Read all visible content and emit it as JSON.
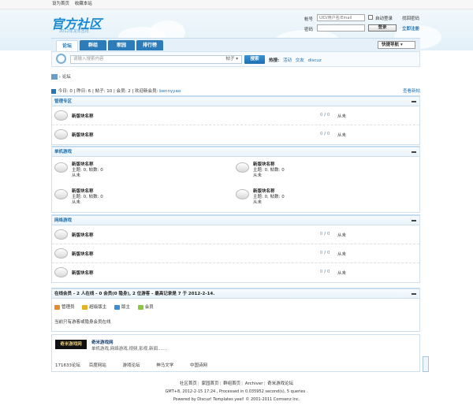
{
  "topbar": {
    "set_home": "设为首页",
    "bookmark": "收藏本站"
  },
  "logo": {
    "title": "官方社区",
    "subtitle": "2012年龙年吉祥"
  },
  "login": {
    "account_label": "帐号",
    "account_placeholder": "UID/用户名/Email",
    "remember": "自动登录",
    "forgot": "找回密码",
    "password_label": "密码",
    "login_button": "登录",
    "register": "立即注册"
  },
  "nav": {
    "tabs": [
      "论坛",
      "群组",
      "家园",
      "排行榜"
    ],
    "quick": "快捷导航"
  },
  "search": {
    "placeholder": "请输入搜索内容",
    "type": "帖子",
    "button": "搜索",
    "hot_label": "热搜:",
    "hot": [
      "活动",
      "交友",
      "discuz"
    ]
  },
  "breadcrumb": {
    "current": "论坛"
  },
  "stats": {
    "text": "今日: 0 | 昨日: 6 | 帖子: 10 | 会员: 2 | 欢迎新会员:",
    "new_member": "bennyyao",
    "latest": "查看新帖"
  },
  "sections": {
    "admin": {
      "title": "管理专区",
      "forums": [
        {
          "name": "新版块名称",
          "count": "0",
          "posts": "0",
          "last": "从未"
        },
        {
          "name": "新版块名称",
          "count": "0",
          "posts": "0",
          "last": "从未"
        }
      ]
    },
    "single": {
      "title": "单机游戏",
      "forums": [
        {
          "name": "新版块名称",
          "meta": "主题: 0, 帖数: 0",
          "last": "从未"
        },
        {
          "name": "新版块名称",
          "meta": "主题: 0, 帖数: 0",
          "last": "从未"
        },
        {
          "name": "新版块名称",
          "meta": "主题: 0, 帖数: 0",
          "last": "从未"
        },
        {
          "name": "新版块名称",
          "meta": "主题: 0, 帖数: 0",
          "last": "从未"
        }
      ]
    },
    "online_game": {
      "title": "网络游戏",
      "forums": [
        {
          "name": "新版块名称",
          "count": "0",
          "posts": "0",
          "last": "从未"
        },
        {
          "name": "新版块名称",
          "count": "0",
          "posts": "0",
          "last": "从未"
        },
        {
          "name": "新版块名称",
          "count": "0",
          "posts": "0",
          "last": "从未"
        }
      ]
    }
  },
  "online": {
    "title": "在线会员 - 2 人在线 - 0 会员(0 隐身), 2 位游客 - 最高记录是 7 于 2012-2-14.",
    "legend": [
      {
        "label": "管理员",
        "color": "#e78a2e"
      },
      {
        "label": "超级版主",
        "color": "#e4b325"
      },
      {
        "label": "版主",
        "color": "#3b8ed4"
      },
      {
        "label": "会员",
        "color": "#8dc63f"
      }
    ],
    "note": "当前只有游客或隐身会员在线"
  },
  "friends": {
    "logo_text": "奇米游戏网",
    "name": "奇米游戏网",
    "desc": "单机游戏,网络游戏,视频,影视,新闻.......",
    "links": [
      "171633论坛",
      "百度网站",
      "游戏论坛",
      "神马文学",
      "中国诗网"
    ]
  },
  "footer": {
    "links": [
      "社区首页",
      "家园首页",
      "群组首页",
      "Archiver",
      "奇米游戏论坛"
    ],
    "info": "GMT+8, 2012-2-15 17:24 , Processed in 0.035952 second(s), 5 queries .",
    "powered": "Powered by Discuz! Templates yeei! © 2001-2011 Comsenz Inc."
  }
}
